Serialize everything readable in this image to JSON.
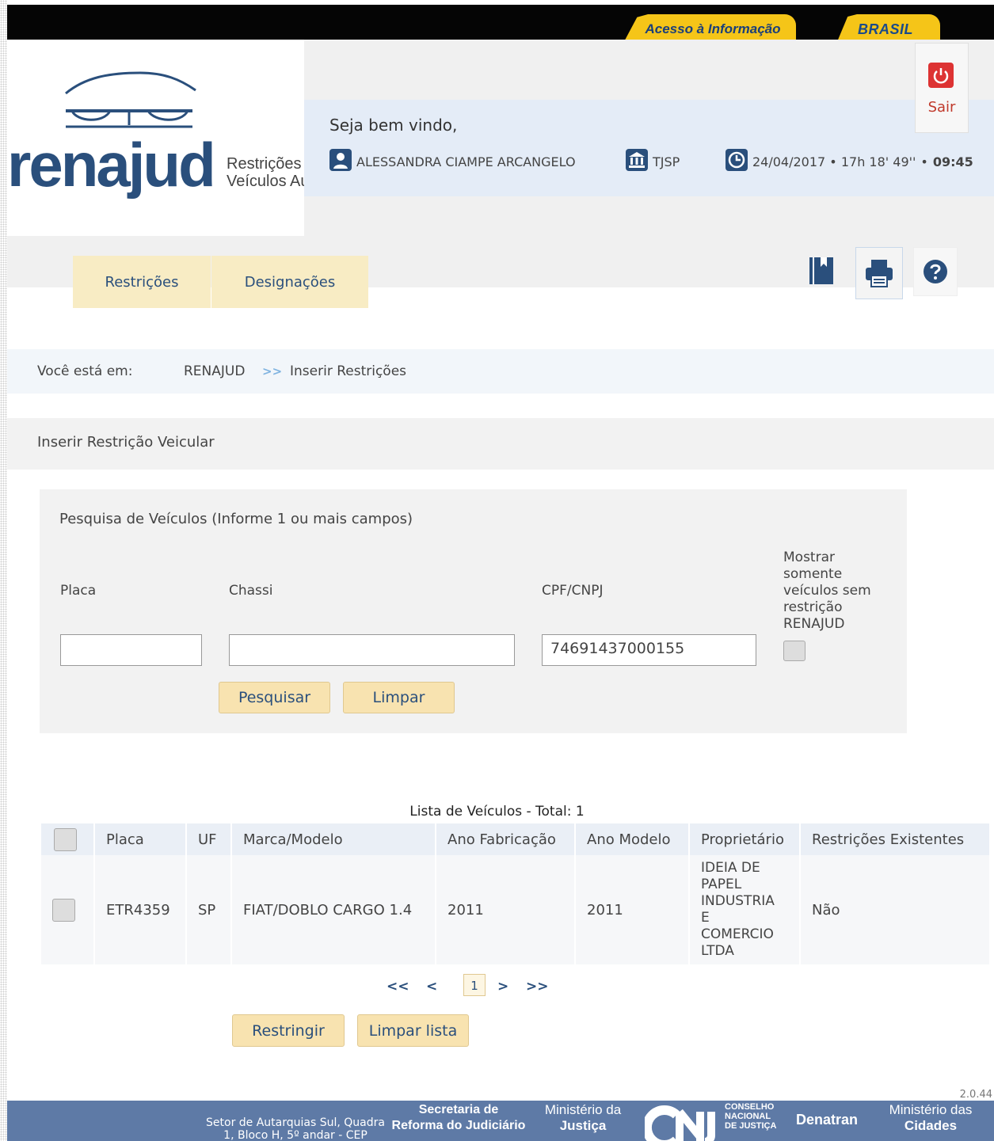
{
  "gov_bar": {
    "acesso": "Acesso à Informação",
    "brasil": "BRASIL"
  },
  "logo": {
    "name": "renajud",
    "tagline_1": "Restrições",
    "tagline_2": "Veículos Au"
  },
  "header": {
    "welcome": "Seja bem vindo,",
    "user": "ALESSANDRA CIAMPE ARCANGELO",
    "court": "TJSP",
    "datetime": "24/04/2017 • 17h 18' 49''",
    "session_sep": "•",
    "session_time": "09:45",
    "logout": "Sair"
  },
  "menu": {
    "restricoes": "Restrições",
    "designacoes": "Designações"
  },
  "breadcrumb": {
    "prefix": "Você está em:",
    "root": "RENAJUD",
    "sep": ">>",
    "current": "Inserir Restrições"
  },
  "section_title": "Inserir Restrição Veicular",
  "search": {
    "title": "Pesquisa de Veículos (Informe 1 ou mais campos)",
    "placa_label": "Placa",
    "chassi_label": "Chassi",
    "cpf_label": "CPF/CNPJ",
    "cpf_value": "74691437000155",
    "only_free_1": "Mostrar",
    "only_free_2": "somente",
    "only_free_3": "veículos sem",
    "only_free_4": "restrição",
    "only_free_5": "RENAJUD",
    "search_button": "Pesquisar",
    "clear_button": "Limpar"
  },
  "list": {
    "caption": "Lista de Veículos - Total: 1",
    "headers": [
      "Placa",
      "UF",
      "Marca/Modelo",
      "Ano Fabricação",
      "Ano Modelo",
      "Proprietário",
      "Restrições Existentes"
    ],
    "rows": [
      {
        "placa": "ETR4359",
        "uf": "SP",
        "modelo": "FIAT/DOBLO CARGO 1.4",
        "ano_fab": "2011",
        "ano_mod": "2011",
        "owner_lines": [
          "IDEIA DE",
          "PAPEL",
          "INDUSTRIA",
          "E",
          "COMERCIO",
          "LTDA"
        ],
        "restricoes": "Não"
      }
    ],
    "pager": {
      "first": "<<",
      "prev": "<",
      "page": "1",
      "next": ">",
      "last": ">>"
    },
    "restrict_button": "Restringir",
    "clear_list_button": "Limpar lista"
  },
  "footer": {
    "address_1": "Setor de Autarquias Sul, Quadra",
    "address_2": "1, Bloco H, 5º andar - CEP",
    "sec_1": "Secretaria de",
    "sec_2": "Reforma do Judiciário",
    "min_1": "Ministério da",
    "min_2": "Justiça",
    "cnj_1": "CONSELHO",
    "cnj_2": "NACIONAL",
    "cnj_3": "DE JUSTIÇA",
    "denatran": "Denatran",
    "cid_1": "Ministério das",
    "cid_2": "Cidades",
    "version": "2.0.44"
  }
}
